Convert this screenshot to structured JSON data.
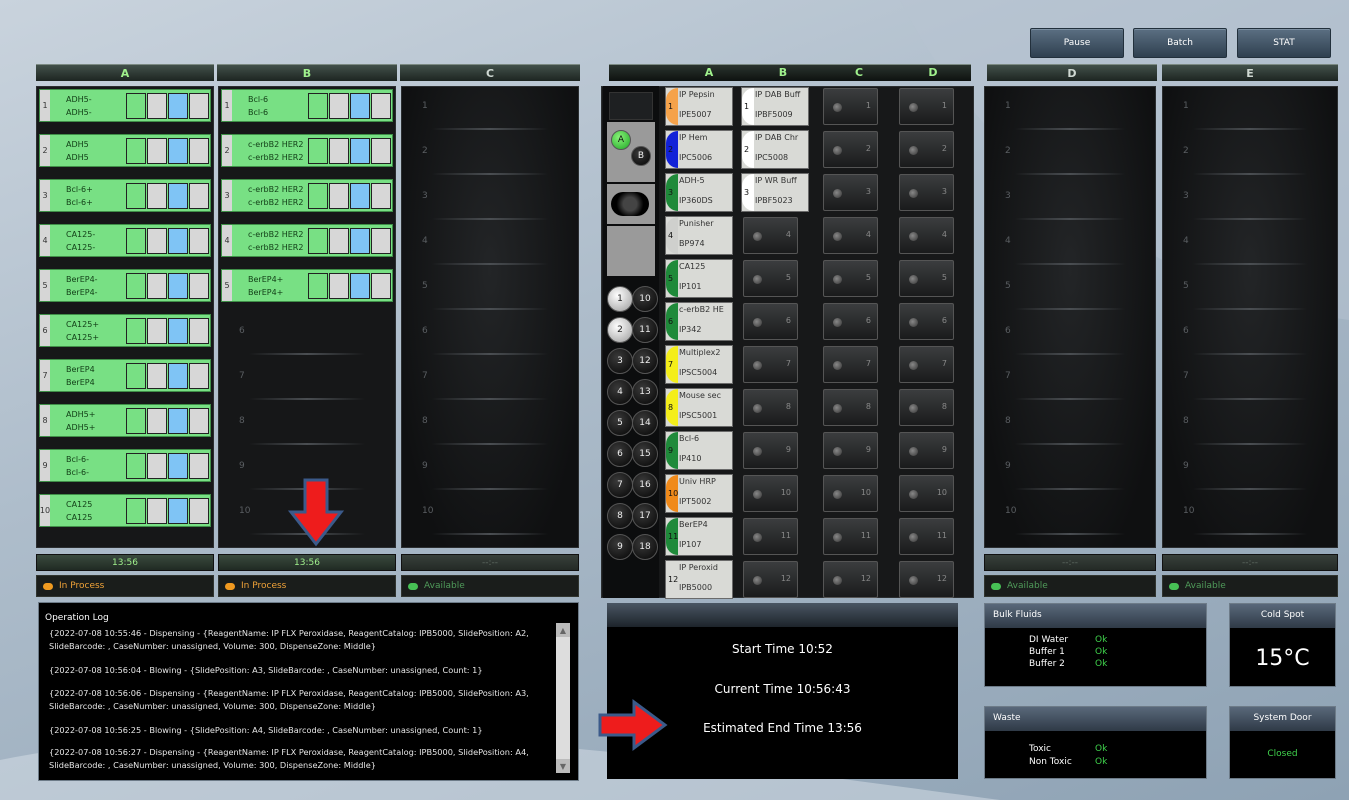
{
  "top_buttons": {
    "pause": "Pause",
    "batch": "Batch",
    "stat": "STAT"
  },
  "headers": {
    "left": [
      "A",
      "B",
      "C"
    ],
    "reagent": [
      "A",
      "B",
      "C",
      "D"
    ],
    "right": [
      "D",
      "E"
    ]
  },
  "tray_a": [
    {
      "n": "1",
      "l1": "ADH5-",
      "l2": "ADH5-"
    },
    {
      "n": "2",
      "l1": "ADH5",
      "l2": "ADH5"
    },
    {
      "n": "3",
      "l1": "Bcl-6+",
      "l2": "Bcl-6+"
    },
    {
      "n": "4",
      "l1": "CA125-",
      "l2": "CA125-"
    },
    {
      "n": "5",
      "l1": "BerEP4-",
      "l2": "BerEP4-"
    },
    {
      "n": "6",
      "l1": "CA125+",
      "l2": "CA125+"
    },
    {
      "n": "7",
      "l1": "BerEP4",
      "l2": "BerEP4"
    },
    {
      "n": "8",
      "l1": "ADH5+",
      "l2": "ADH5+"
    },
    {
      "n": "9",
      "l1": "Bcl-6-",
      "l2": "Bcl-6-"
    },
    {
      "n": "10",
      "l1": "CA125",
      "l2": "CA125"
    }
  ],
  "tray_b": [
    {
      "n": "1",
      "l1": "Bcl-6",
      "l2": "Bcl-6"
    },
    {
      "n": "2",
      "l1": "c-erbB2 HER2",
      "l2": "c-erbB2 HER2"
    },
    {
      "n": "3",
      "l1": "c-erbB2 HER2",
      "l2": "c-erbB2 HER2"
    },
    {
      "n": "4",
      "l1": "c-erbB2 HER2",
      "l2": "c-erbB2 HER2"
    },
    {
      "n": "5",
      "l1": "BerEP4+",
      "l2": "BerEP4+"
    }
  ],
  "slot_numbers": [
    "1",
    "2",
    "3",
    "4",
    "5",
    "6",
    "7",
    "8",
    "9",
    "10"
  ],
  "times": {
    "a": "13:56",
    "b": "13:56",
    "c": "--:--",
    "d": "--:--",
    "e": "--:--"
  },
  "status": {
    "a": "In Process",
    "b": "In Process",
    "c": "Available",
    "d": "Available",
    "e": "Available"
  },
  "bulk_vials": {
    "a": "A",
    "b": "B",
    "left": [
      "1",
      "2",
      "3",
      "4",
      "5",
      "6",
      "7",
      "8",
      "9"
    ],
    "right": [
      "10",
      "11",
      "12",
      "13",
      "14",
      "15",
      "16",
      "17",
      "18"
    ]
  },
  "reagents_a": [
    {
      "n": "1",
      "name": "IP Pepsin",
      "cat": "IPE5007",
      "color": "#f5a24a"
    },
    {
      "n": "2",
      "name": "IP Hem",
      "cat": "IPC5006",
      "color": "#1222d8"
    },
    {
      "n": "3",
      "name": "ADH-5",
      "cat": "IP360DS",
      "color": "#1f8a3a"
    },
    {
      "n": "4",
      "name": "Punisher",
      "cat": "BP974",
      "color": "#cfd0cd"
    },
    {
      "n": "5",
      "name": "CA125",
      "cat": "IP101",
      "color": "#1f8a3a"
    },
    {
      "n": "6",
      "name": "c-erbB2 HE",
      "cat": "IP342",
      "color": "#1f8a3a"
    },
    {
      "n": "7",
      "name": "Multiplex2",
      "cat": "IPSC5004",
      "color": "#f4ee1a"
    },
    {
      "n": "8",
      "name": "Mouse sec",
      "cat": "IPSC5001",
      "color": "#f4ee1a"
    },
    {
      "n": "9",
      "name": "Bcl-6",
      "cat": "IP410",
      "color": "#1f8a3a"
    },
    {
      "n": "10",
      "name": "Univ HRP",
      "cat": "IPT5002",
      "color": "#f08a1a"
    },
    {
      "n": "11",
      "name": "BerEP4",
      "cat": "IP107",
      "color": "#1f8a3a"
    },
    {
      "n": "12",
      "name": "IP Peroxid",
      "cat": "IPB5000",
      "color": "#d9dad6"
    }
  ],
  "reagents_b": [
    {
      "n": "1",
      "name": "IP DAB Buff",
      "cat": "IPBF5009",
      "color": "#ffffff"
    },
    {
      "n": "2",
      "name": "IP DAB Chr",
      "cat": "IPC5008",
      "color": "#ffffff"
    },
    {
      "n": "3",
      "name": "IP WR Buff",
      "cat": "IPBF5023",
      "color": "#ffffff"
    }
  ],
  "log": {
    "title": "Operation Log",
    "entries": [
      "{2022-07-08 10:55:46 - Dispensing - {ReagentName: IP FLX Peroxidase, ReagentCatalog: IPB5000, SlidePosition: A2, SlideBarcode: , CaseNumber: unassigned, Volume: 300, DispenseZone: Middle}",
      "{2022-07-08 10:56:04 - Blowing - {SlidePosition: A3, SlideBarcode: , CaseNumber: unassigned, Count: 1}",
      "{2022-07-08 10:56:06 - Dispensing - {ReagentName: IP FLX Peroxidase, ReagentCatalog: IPB5000, SlidePosition: A3, SlideBarcode: , CaseNumber: unassigned, Volume: 300, DispenseZone: Middle}",
      "{2022-07-08 10:56:25 - Blowing - {SlidePosition: A4, SlideBarcode: , CaseNumber: unassigned, Count: 1}",
      "{2022-07-08 10:56:27 - Dispensing - {ReagentName: IP FLX Peroxidase, ReagentCatalog: IPB5000, SlidePosition: A4, SlideBarcode: , CaseNumber: unassigned, Volume: 300, DispenseZone: Middle}"
    ]
  },
  "times_panel": {
    "start": "Start Time  10:52",
    "current": "Current Time  10:56:43",
    "end": "Estimated End Time  13:56"
  },
  "bulk_fluids": {
    "title": "Bulk Fluids",
    "items": [
      {
        "name": "DI Water",
        "status": "Ok"
      },
      {
        "name": "Buffer 1",
        "status": "Ok"
      },
      {
        "name": "Buffer 2",
        "status": "Ok"
      }
    ]
  },
  "waste": {
    "title": "Waste",
    "items": [
      {
        "name": "Toxic",
        "status": "Ok"
      },
      {
        "name": "Non Toxic",
        "status": "Ok"
      }
    ]
  },
  "cold_spot": {
    "title": "Cold Spot",
    "value": "15°C"
  },
  "system_door": {
    "title": "System Door",
    "value": "Closed"
  },
  "colors": {
    "slide_green": "#78e084",
    "slide_blue": "#7fc4f5",
    "status_ok": "#3fd14c",
    "arrow_red": "#ee1c1c",
    "arrow_outline": "#3b5a8a"
  }
}
